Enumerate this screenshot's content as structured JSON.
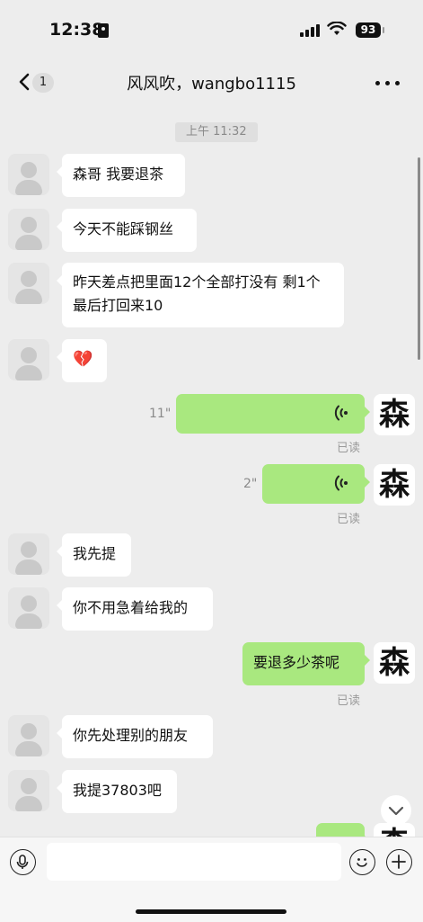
{
  "status_bar": {
    "time": "12:38",
    "battery": "93"
  },
  "header": {
    "back_badge": "1",
    "title": "风风吹，wangbo1115"
  },
  "chat": {
    "timestamp": "上午 11:32",
    "messages": [
      {
        "side": "left",
        "text": "森哥 我要退茶"
      },
      {
        "side": "left",
        "text": "今天不能踩钢丝"
      },
      {
        "side": "left",
        "text": "昨天差点把里面12个全部打没有 剩1个 最后打回来10"
      },
      {
        "side": "left",
        "text": "💔"
      },
      {
        "side": "right",
        "type": "voice",
        "duration": "11\"",
        "status": "已读"
      },
      {
        "side": "right",
        "type": "voice",
        "duration": "2\"",
        "status": "已读"
      },
      {
        "side": "left",
        "text": "我先提"
      },
      {
        "side": "left",
        "text": "你不用急着给我的"
      },
      {
        "side": "right",
        "text": "要退多少茶呢",
        "status": "已读"
      },
      {
        "side": "left",
        "text": "你先处理别的朋友"
      },
      {
        "side": "left",
        "text": "我提37803吧"
      }
    ],
    "my_avatar_char": "森"
  },
  "colors": {
    "sent_bubble": "#a9e87f",
    "received_bubble": "#ffffff",
    "background": "#ededed"
  }
}
